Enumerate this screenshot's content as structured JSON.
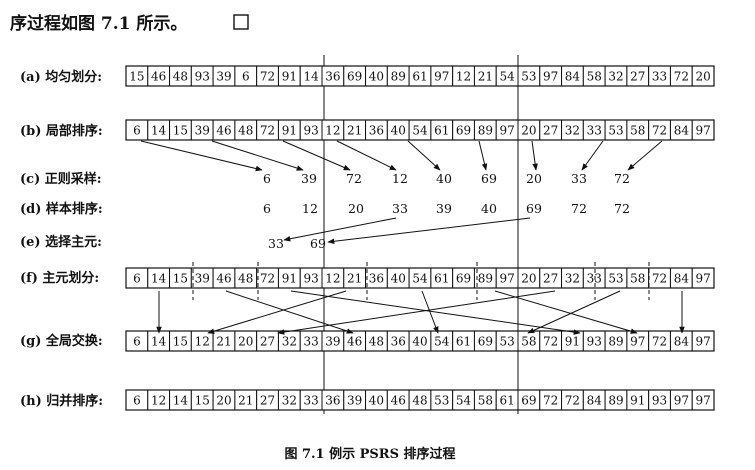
{
  "intro_text": "序过程如图 7.1 所示。",
  "caption": "图 7.1 例示 PSRS 排序过程",
  "rows": [
    {
      "id": "a",
      "label": "(a) 均匀划分:",
      "values": [
        15,
        46,
        48,
        93,
        39,
        6,
        72,
        91,
        14,
        36,
        69,
        40,
        89,
        61,
        97,
        12,
        21,
        54,
        53,
        97,
        84,
        58,
        32,
        27,
        33,
        72,
        20
      ]
    },
    {
      "id": "b",
      "label": "(b) 局部排序:",
      "values": [
        6,
        14,
        15,
        39,
        46,
        48,
        72,
        91,
        93,
        12,
        21,
        36,
        40,
        54,
        61,
        69,
        89,
        97,
        20,
        27,
        32,
        33,
        53,
        58,
        72,
        84,
        97
      ]
    },
    {
      "id": "f",
      "label": "(f) 主元划分:",
      "values": [
        6,
        14,
        15,
        39,
        46,
        48,
        72,
        91,
        93,
        12,
        21,
        36,
        40,
        54,
        61,
        69,
        89,
        97,
        20,
        27,
        32,
        33,
        53,
        58,
        72,
        84,
        97
      ]
    },
    {
      "id": "g",
      "label": "(g) 全局交换:",
      "values": [
        6,
        14,
        15,
        12,
        21,
        20,
        27,
        32,
        33,
        39,
        46,
        48,
        36,
        40,
        54,
        61,
        69,
        53,
        58,
        72,
        91,
        93,
        89,
        97,
        72,
        84,
        97
      ]
    },
    {
      "id": "h",
      "label": "(h) 归并排序:",
      "values": [
        6,
        12,
        14,
        15,
        20,
        21,
        27,
        32,
        33,
        36,
        39,
        40,
        46,
        48,
        53,
        54,
        58,
        61,
        69,
        72,
        72,
        84,
        89,
        91,
        93,
        97,
        97
      ]
    }
  ],
  "regular_sampling": {
    "label": "(c) 正则采样:",
    "values": [
      "6",
      "39",
      "72",
      "12",
      "40",
      "69",
      "20",
      "33",
      "72"
    ]
  },
  "sample_sorting": {
    "label": "(d) 样本排序:",
    "values": [
      "6",
      "12",
      "20",
      "33",
      "39",
      "40",
      "69",
      "72",
      "72"
    ]
  },
  "pivot_selection": {
    "label": "(e) 选择主元:",
    "values": [
      "33",
      "69"
    ]
  }
}
